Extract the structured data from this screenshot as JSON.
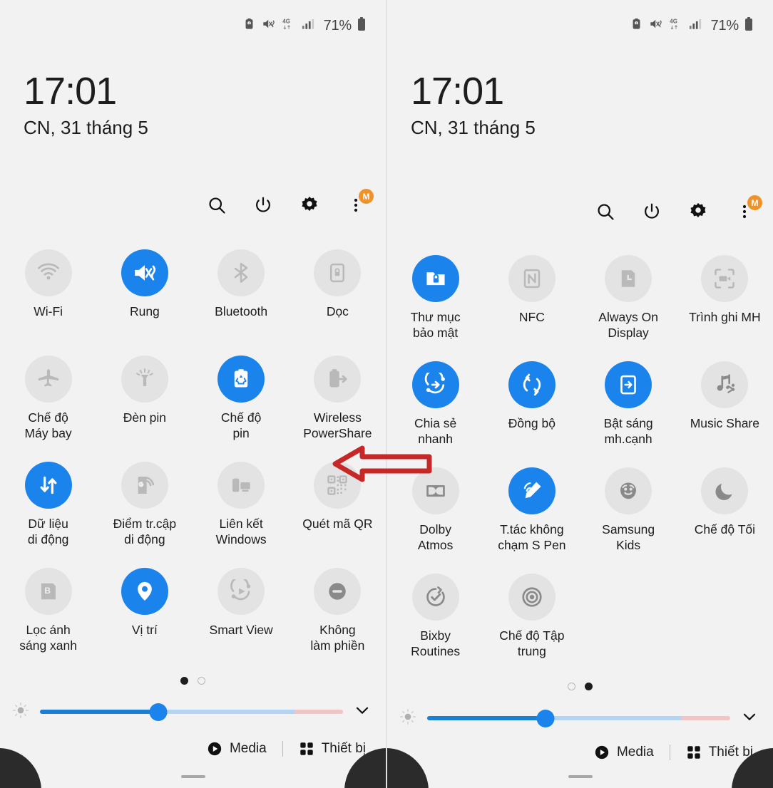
{
  "statusbar": {
    "icons": [
      "alarm-icon",
      "mute-vibrate-icon",
      "network-4g-icon",
      "signal-bars-icon"
    ],
    "battery_text": "71%",
    "battery_icon": "battery-icon"
  },
  "clock": {
    "time": "17:01",
    "date": "CN, 31 tháng 5"
  },
  "actions": {
    "search": "search-icon",
    "power": "power-icon",
    "settings": "gear-icon",
    "more": "more-vertical-icon",
    "badge": "M"
  },
  "colors": {
    "accent_blue": "#1b84ec",
    "tile_off": "#e3e3e3",
    "background": "#f2f2f2",
    "badge_orange": "#f0922b",
    "annotation_red": "#c62828",
    "slider_blue": "#1b7fd4",
    "slider_lightblue": "#b3d4f2",
    "slider_pink": "#f2c5c5"
  },
  "left_panel": {
    "page": 1,
    "tiles": [
      {
        "label": "Wi-Fi",
        "icon": "wifi-icon",
        "on": false
      },
      {
        "label": "Rung",
        "icon": "vibrate-icon",
        "on": true
      },
      {
        "label": "Bluetooth",
        "icon": "bluetooth-icon",
        "on": false
      },
      {
        "label": "Dọc",
        "icon": "rotation-lock-icon",
        "on": false
      },
      {
        "label": "Chế độ\nMáy bay",
        "icon": "airplane-icon",
        "on": false
      },
      {
        "label": "Đèn pin",
        "icon": "flashlight-icon",
        "on": false
      },
      {
        "label": "Chế độ\npin",
        "icon": "power-saving-icon",
        "on": true
      },
      {
        "label": "Wireless\nPowerShare",
        "icon": "wireless-powershare-icon",
        "on": false
      },
      {
        "label": "Dữ liệu\ndi động",
        "icon": "mobile-data-icon",
        "on": true
      },
      {
        "label": "Điểm tr.cập\ndi động",
        "icon": "hotspot-icon",
        "on": false
      },
      {
        "label": "Liên kết\nWindows",
        "icon": "link-to-windows-icon",
        "on": false
      },
      {
        "label": "Quét mã QR",
        "icon": "qr-scan-icon",
        "on": false
      },
      {
        "label": "Lọc ánh\nsáng xanh",
        "icon": "blue-light-filter-icon",
        "on": false
      },
      {
        "label": "Vị trí",
        "icon": "location-pin-icon",
        "on": true
      },
      {
        "label": "Smart View",
        "icon": "smart-view-icon",
        "on": false
      },
      {
        "label": "Không\nlàm phiền",
        "icon": "do-not-disturb-icon",
        "on": false
      }
    ],
    "dots": [
      true,
      false
    ],
    "brightness_percent": 39,
    "bottom": {
      "media": "Media",
      "devices": "Thiết bị"
    }
  },
  "right_panel": {
    "page": 2,
    "tiles": [
      {
        "label": "Thư mục\nbảo mật",
        "icon": "secure-folder-icon",
        "on": true
      },
      {
        "label": "NFC",
        "icon": "nfc-icon",
        "on": false
      },
      {
        "label": "Always On\nDisplay",
        "icon": "always-on-display-icon",
        "on": false
      },
      {
        "label": "Trình ghi MH",
        "icon": "screen-recorder-icon",
        "on": false
      },
      {
        "label": "Chia sẻ\nnhanh",
        "icon": "quick-share-icon",
        "on": true
      },
      {
        "label": "Đồng bộ",
        "icon": "sync-icon",
        "on": true
      },
      {
        "label": "Bật sáng\nmh.cạnh",
        "icon": "edge-lighting-icon",
        "on": true
      },
      {
        "label": "Music Share",
        "icon": "music-share-icon",
        "on": false
      },
      {
        "label": "Dolby\nAtmos",
        "icon": "dolby-atmos-icon",
        "on": false
      },
      {
        "label": "T.tác không\nchạm S Pen",
        "icon": "s-pen-air-actions-icon",
        "on": true
      },
      {
        "label": "Samsung\nKids",
        "icon": "samsung-kids-icon",
        "on": false
      },
      {
        "label": "Chế độ Tối",
        "icon": "dark-mode-moon-icon",
        "on": false
      },
      {
        "label": "Bixby\nRoutines",
        "icon": "bixby-routines-icon",
        "on": false
      },
      {
        "label": "Chế độ Tập\ntrung",
        "icon": "focus-mode-icon",
        "on": false
      }
    ],
    "dots": [
      false,
      true
    ],
    "brightness_percent": 39,
    "bottom": {
      "media": "Media",
      "devices": "Thiết bị"
    }
  },
  "annotation": {
    "type": "left-arrow",
    "color": "#c62828"
  }
}
